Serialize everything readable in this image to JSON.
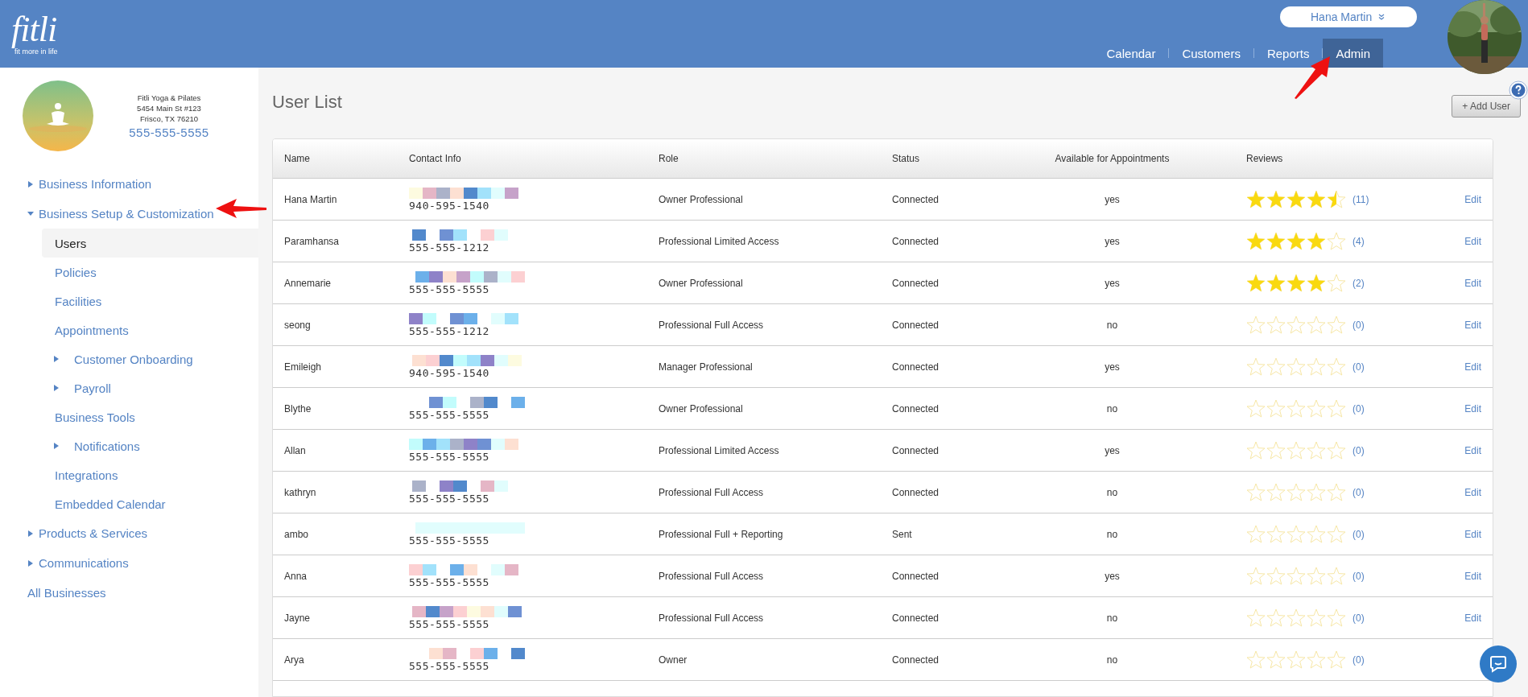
{
  "header": {
    "logo": "fitli",
    "tagline": "fit more in life",
    "user_name": "Hana Martin",
    "nav": [
      {
        "label": "Calendar",
        "selected": false
      },
      {
        "label": "Customers",
        "selected": false
      },
      {
        "label": "Reports",
        "selected": false
      },
      {
        "label": "Admin",
        "selected": true
      }
    ]
  },
  "business": {
    "name": "Fitli Yoga & Pilates",
    "address_line_1": "5454 Main St #123",
    "address_line_2": "Frisco, TX 76210",
    "phone": "555-555-5555"
  },
  "sidebar": {
    "items": [
      {
        "kind": "group",
        "label": "Business Information",
        "expanded": false
      },
      {
        "kind": "group",
        "label": "Business Setup & Customization",
        "expanded": true,
        "children": [
          {
            "kind": "link",
            "label": "Users",
            "selected": true
          },
          {
            "kind": "link",
            "label": "Policies",
            "selected": false
          },
          {
            "kind": "link",
            "label": "Facilities",
            "selected": false
          },
          {
            "kind": "link",
            "label": "Appointments",
            "selected": false
          },
          {
            "kind": "group",
            "label": "Customer Onboarding",
            "selected": false
          },
          {
            "kind": "group",
            "label": "Payroll",
            "selected": false
          },
          {
            "kind": "link",
            "label": "Business Tools",
            "selected": false
          },
          {
            "kind": "group",
            "label": "Notifications",
            "selected": false
          },
          {
            "kind": "link",
            "label": "Integrations",
            "selected": false
          },
          {
            "kind": "link",
            "label": "Embedded Calendar",
            "selected": false
          }
        ]
      },
      {
        "kind": "group",
        "label": "Products & Services",
        "expanded": false
      },
      {
        "kind": "group",
        "label": "Communications",
        "expanded": false
      },
      {
        "kind": "link",
        "label": "All Businesses"
      }
    ]
  },
  "page": {
    "title": "User List",
    "add_button": "+ Add User"
  },
  "table": {
    "columns": [
      "Name",
      "Contact Info",
      "Role",
      "Status",
      "Available for Appointments",
      "Reviews"
    ],
    "rows": [
      {
        "name": "Hana Martin",
        "phone": "940-595-1540",
        "role": "Owner Professional",
        "status": "Connected",
        "available": "yes",
        "stars": 4.5,
        "review_count": "(11)",
        "action": "Edit"
      },
      {
        "name": "Paramhansa",
        "phone": "555-555-1212",
        "role": "Professional Limited Access",
        "status": "Connected",
        "available": "yes",
        "stars": 4,
        "review_count": "(4)",
        "action": "Edit"
      },
      {
        "name": "Annemarie",
        "phone": "555-555-5555",
        "role": "Owner Professional",
        "status": "Connected",
        "available": "yes",
        "stars": 4,
        "review_count": "(2)",
        "action": "Edit"
      },
      {
        "name": "seong",
        "phone": "555-555-1212",
        "role": "Professional Full Access",
        "status": "Connected",
        "available": "no",
        "stars": 0,
        "review_count": "(0)",
        "action": "Edit"
      },
      {
        "name": "Emileigh",
        "phone": "940-595-1540",
        "role": "Manager Professional",
        "status": "Connected",
        "available": "yes",
        "stars": 0,
        "review_count": "(0)",
        "action": "Edit"
      },
      {
        "name": "Blythe",
        "phone": "555-555-5555",
        "role": "Owner Professional",
        "status": "Connected",
        "available": "no",
        "stars": 0,
        "review_count": "(0)",
        "action": "Edit"
      },
      {
        "name": "Allan",
        "phone": "555-555-5555",
        "role": "Professional Limited Access",
        "status": "Connected",
        "available": "yes",
        "stars": 0,
        "review_count": "(0)",
        "action": "Edit"
      },
      {
        "name": "kathryn",
        "phone": "555-555-5555",
        "role": "Professional Full Access",
        "status": "Connected",
        "available": "no",
        "stars": 0,
        "review_count": "(0)",
        "action": "Edit"
      },
      {
        "name": "ambo",
        "phone": "555-555-5555",
        "role": "Professional Full + Reporting",
        "status": "Sent",
        "available": "no",
        "stars": 0,
        "review_count": "(0)",
        "action": "Edit"
      },
      {
        "name": "Anna",
        "phone": "555-555-5555",
        "role": "Professional Full Access",
        "status": "Connected",
        "available": "yes",
        "stars": 0,
        "review_count": "(0)",
        "action": "Edit"
      },
      {
        "name": "Jayne",
        "phone": "555-555-5555",
        "role": "Professional Full Access",
        "status": "Connected",
        "available": "no",
        "stars": 0,
        "review_count": "(0)",
        "action": "Edit"
      },
      {
        "name": "Arya",
        "phone": "555-555-5555",
        "role": "Owner",
        "status": "Connected",
        "available": "no",
        "stars": 0,
        "review_count": "(0)"
      }
    ]
  }
}
